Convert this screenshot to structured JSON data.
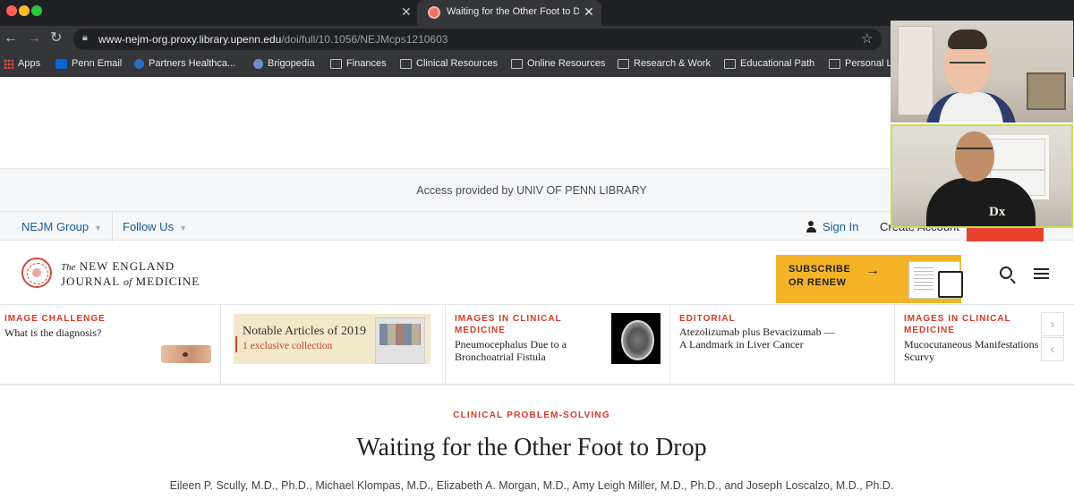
{
  "browser": {
    "active_tab_title": "Waiting for the Other Foot to Drop",
    "url_host": "www-nejm-org.proxy.library.upenn.edu",
    "url_path": "/doi/full/10.1056/NEJMcps1210603"
  },
  "bookmarks": [
    {
      "label": "Apps",
      "icon": "apps-grid-icon"
    },
    {
      "label": "Penn Email",
      "icon": "outlook-icon"
    },
    {
      "label": "Partners Healthca...",
      "icon": "partners-icon"
    },
    {
      "label": "Brigopedia",
      "icon": "brigopedia-icon"
    },
    {
      "label": "Finances",
      "icon": "folder-icon"
    },
    {
      "label": "Clinical Resources",
      "icon": "folder-icon"
    },
    {
      "label": "Online Resources",
      "icon": "folder-icon"
    },
    {
      "label": "Research & Work",
      "icon": "folder-icon"
    },
    {
      "label": "Educational Path",
      "icon": "folder-icon"
    },
    {
      "label": "Personal L",
      "icon": "folder-icon"
    }
  ],
  "site": {
    "access_text": "Access provided by UNIV OF PENN LIBRARY",
    "nejm_group": "NEJM Group",
    "follow_us": "Follow Us",
    "sign_in": "Sign In",
    "create_account": "Create Account",
    "brand_the": "The",
    "brand_line1": "NEW ENGLAND",
    "brand_journal": "JOURNAL",
    "brand_of": "of",
    "brand_medicine": "MEDICINE",
    "subscribe_line1": "SUBSCRIBE",
    "subscribe_line2": "OR RENEW"
  },
  "carousel": [
    {
      "label": "IMAGE CHALLENGE",
      "text": "What is the diagnosis?"
    },
    {
      "label": "",
      "title": "Notable Articles of 2019",
      "text": "1 exclusive collection"
    },
    {
      "label": "IMAGES IN CLINICAL MEDICINE",
      "text": "Pneumocephalus Due to a Bronchoatrial Fistula"
    },
    {
      "label": "EDITORIAL",
      "text": "Atezolizumab plus Bevacizumab — A Landmark in Liver Cancer"
    },
    {
      "label": "IMAGES IN CLINICAL MEDICINE",
      "text": "Mucocutaneous Manifestations of Scurvy"
    }
  ],
  "article": {
    "section": "CLINICAL PROBLEM-SOLVING",
    "title": "Waiting for the Other Foot to Drop",
    "authors": "Eileen P. Scully, M.D., Ph.D., Michael Klompas, M.D., Elizabeth A. Morgan, M.D., Amy Leigh Miller, M.D., Ph.D., and Joseph Loscalzo, M.D., Ph.D."
  },
  "video": {
    "shirt_text": "Dx"
  }
}
